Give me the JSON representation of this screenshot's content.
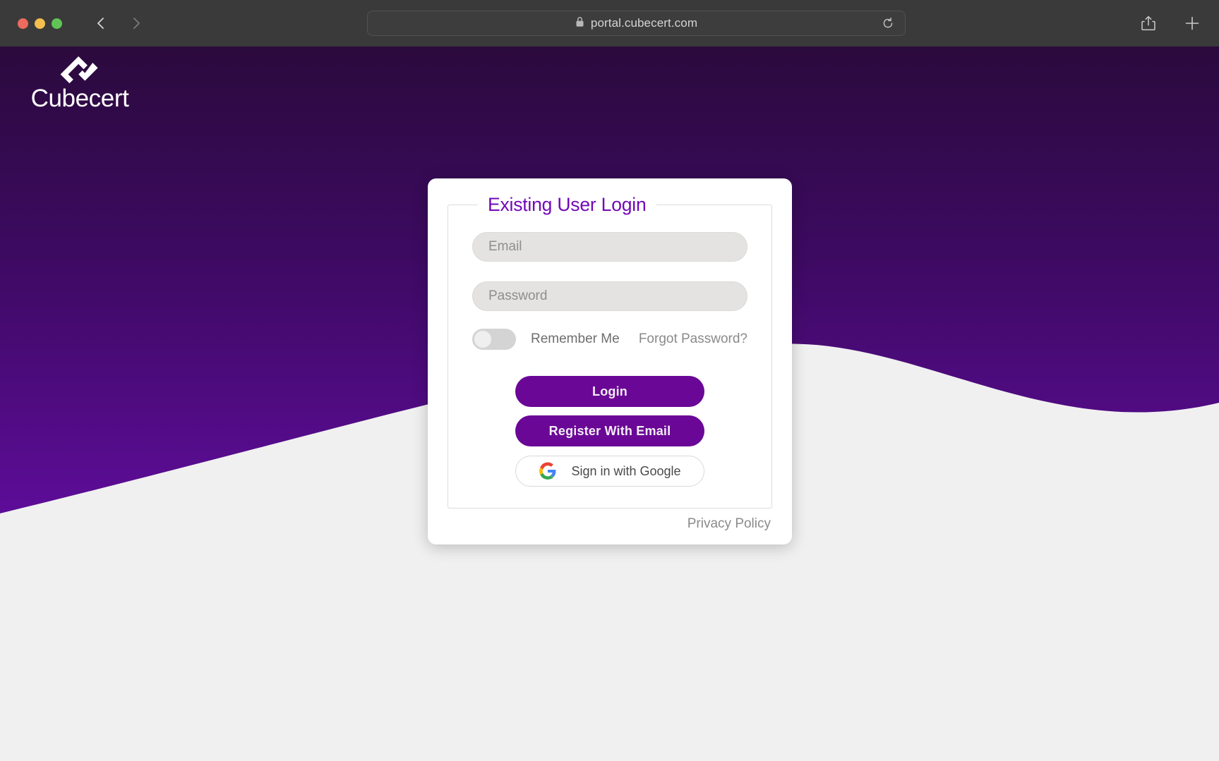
{
  "browser": {
    "url": "portal.cubecert.com",
    "lock_icon": "lock-icon",
    "reload_icon": "reload-icon",
    "back_icon": "chevron-left-icon",
    "forward_icon": "chevron-right-icon",
    "share_icon": "share-icon",
    "new_tab_icon": "plus-icon",
    "traffic_lights": [
      "close",
      "minimize",
      "maximize"
    ]
  },
  "brand": {
    "name": "Cubecert",
    "logo_icon": "cubecert-logo-icon",
    "background_top_color": "#2b0a3d",
    "background_bottom_color": "#5d0c98",
    "accent_color": "#6a0796",
    "page_background": "#f0f0f0"
  },
  "login": {
    "legend": "Existing User Login",
    "email": {
      "placeholder": "Email",
      "value": ""
    },
    "password": {
      "placeholder": "Password",
      "value": ""
    },
    "remember_me": {
      "label": "Remember Me",
      "checked": false
    },
    "forgot_password_label": "Forgot Password?",
    "login_button": "Login",
    "register_button": "Register With Email",
    "google_button": "Sign in with Google",
    "google_icon": "google-g-icon",
    "privacy_policy": "Privacy Policy"
  }
}
